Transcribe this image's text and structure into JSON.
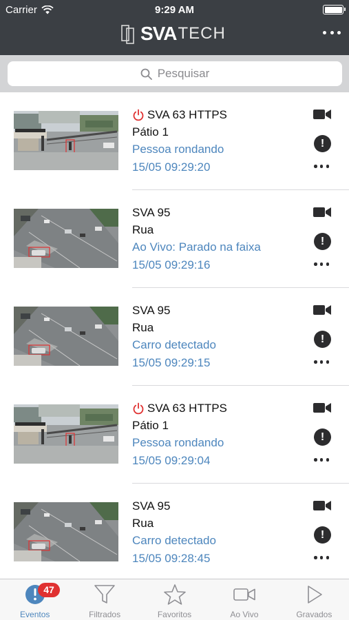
{
  "status_bar": {
    "carrier": "Carrier",
    "time": "9:29 AM"
  },
  "header": {
    "logo_bold": "SVA",
    "logo_light": "TECH"
  },
  "search": {
    "placeholder": "Pesquisar"
  },
  "events": [
    {
      "camera": "SVA 63 HTTPS",
      "offline": true,
      "place": "Pátio 1",
      "event": "Pessoa rondando",
      "time": "15/05 09:29:20",
      "scene": "patio"
    },
    {
      "camera": "SVA 95",
      "offline": false,
      "place": "Rua",
      "event": "Ao Vivo: Parado na faixa",
      "time": "15/05 09:29:16",
      "scene": "street"
    },
    {
      "camera": "SVA 95",
      "offline": false,
      "place": "Rua",
      "event": "Carro detectado",
      "time": "15/05 09:29:15",
      "scene": "street"
    },
    {
      "camera": "SVA 63 HTTPS",
      "offline": true,
      "place": "Pátio 1",
      "event": "Pessoa rondando",
      "time": "15/05 09:29:04",
      "scene": "patio"
    },
    {
      "camera": "SVA 95",
      "offline": false,
      "place": "Rua",
      "event": "Carro detectado",
      "time": "15/05 09:28:45",
      "scene": "street"
    }
  ],
  "tabs": [
    {
      "label": "Eventos",
      "icon": "alert-icon",
      "active": true,
      "badge": "47"
    },
    {
      "label": "Filtrados",
      "icon": "filter-icon",
      "active": false
    },
    {
      "label": "Favoritos",
      "icon": "star-icon",
      "active": false
    },
    {
      "label": "Ao Vivo",
      "icon": "video-icon",
      "active": false
    },
    {
      "label": "Gravados",
      "icon": "play-icon",
      "active": false
    }
  ],
  "colors": {
    "header": "#3b3f44",
    "accent": "#4d86bd",
    "offline": "#e03131",
    "badge": "#e03131"
  }
}
